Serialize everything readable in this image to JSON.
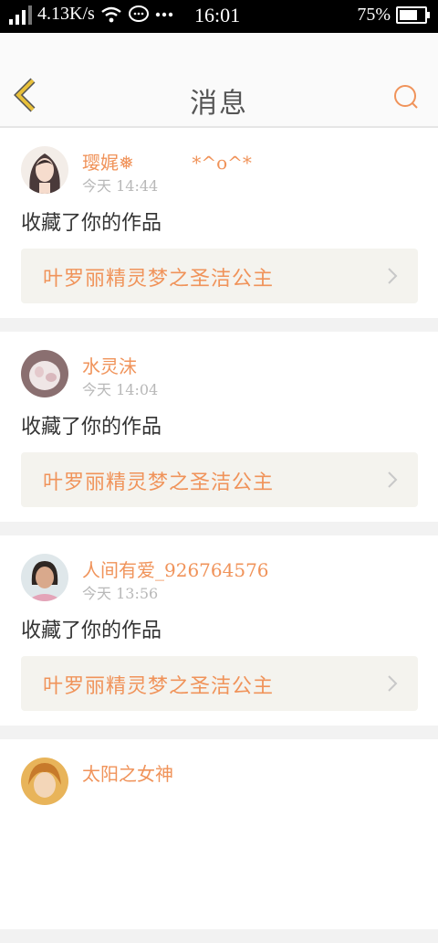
{
  "status_bar": {
    "speed": "4.13K/s",
    "time": "16:01",
    "battery": "75%",
    "battery_level": 0.75
  },
  "header": {
    "title": "消息"
  },
  "messages": [
    {
      "user": "璎娓❅          *^o^*",
      "time": "今天 14:44",
      "action": "收藏了你的作品",
      "work": "叶罗丽精灵梦之圣洁公主"
    },
    {
      "user": "水灵沫",
      "time": "今天 14:04",
      "action": "收藏了你的作品",
      "work": "叶罗丽精灵梦之圣洁公主"
    },
    {
      "user": "人间有爱_926764576",
      "time": "今天 13:56",
      "action": "收藏了你的作品",
      "work": "叶罗丽精灵梦之圣洁公主"
    },
    {
      "user": "太阳之女神"
    }
  ],
  "colors": {
    "accent": "#f0935a",
    "back_arrow": "#e8c03a",
    "muted": "#b8b8b8"
  }
}
